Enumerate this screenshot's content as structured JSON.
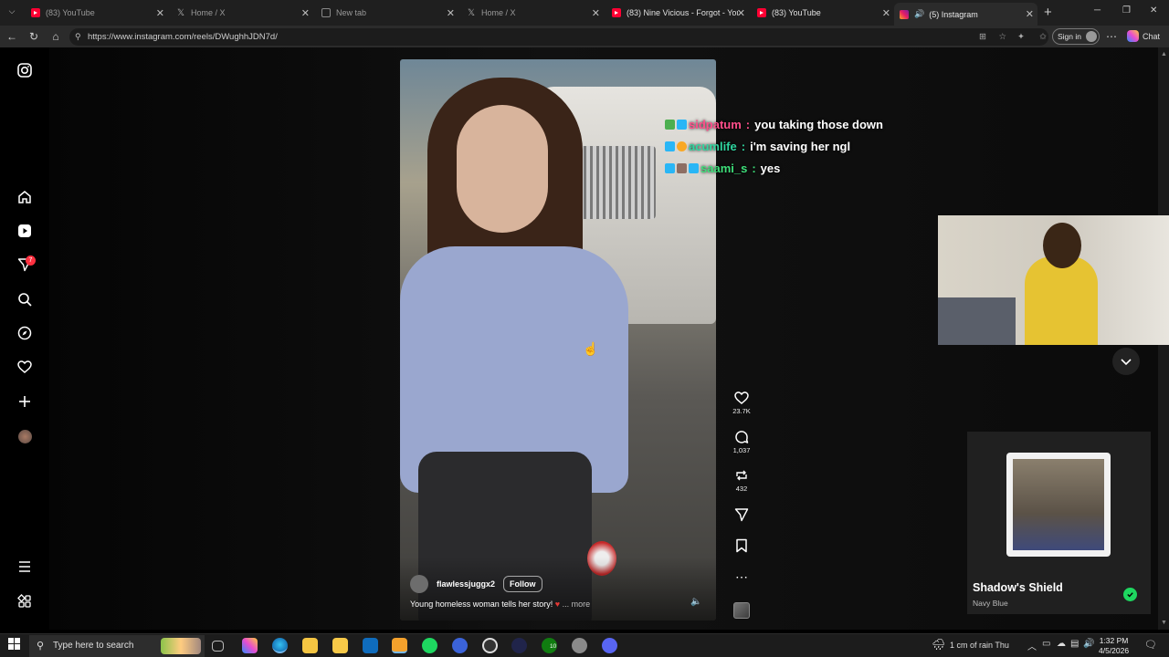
{
  "browser": {
    "tabs": [
      {
        "title": "(83) YouTube",
        "icon": "youtube-icon"
      },
      {
        "title": "Home / X",
        "icon": "x-icon"
      },
      {
        "title": "New tab",
        "icon": "newtab-icon"
      },
      {
        "title": "Home / X",
        "icon": "x-icon"
      },
      {
        "title": "(83) Nine Vicious - Forgot - YouTu",
        "icon": "youtube-icon"
      },
      {
        "title": "(83) YouTube",
        "icon": "youtube-icon"
      },
      {
        "title": "(5) Instagram",
        "icon": "instagram-icon",
        "active": true
      }
    ],
    "url": "https://www.instagram.com/reels/DWughhJDN7d/",
    "sign_in_label": "Sign in",
    "chat_label": "Chat"
  },
  "sidebar": {
    "notification_count": "7",
    "items": [
      "instagram-logo-icon",
      "home-icon",
      "reels-icon",
      "messages-icon",
      "search-icon",
      "explore-icon",
      "notifications-icon",
      "create-icon",
      "profile-avatar",
      "more-menu-icon",
      "meta-apps-icon"
    ]
  },
  "reel": {
    "username": "flawlessjuggx2",
    "follow_label": "Follow",
    "caption": "Young homeless woman tells her story!",
    "caption_more": "... more",
    "likes": "23.7K",
    "comments": "1,037",
    "reposts": "432"
  },
  "stream_chat": [
    {
      "user": "sidpatum",
      "sep": ":",
      "message": "you taking those down",
      "color": "#ff4f8b"
    },
    {
      "user": "acumlife",
      "sep": ":",
      "message": "i'm saving her ngl",
      "color": "#2fd6a0"
    },
    {
      "user": "saami_s",
      "sep": ":",
      "message": "yes",
      "color": "#3ee07a"
    }
  ],
  "now_playing": {
    "title": "Shadow's Shield",
    "artist": "Navy Blue",
    "accent": "#1ed760"
  },
  "taskbar": {
    "search_placeholder": "Type here to search",
    "weather": "1 cm of rain Thu",
    "time": "1:32 PM",
    "date": "4/5/2026",
    "edge_badge": "10"
  }
}
